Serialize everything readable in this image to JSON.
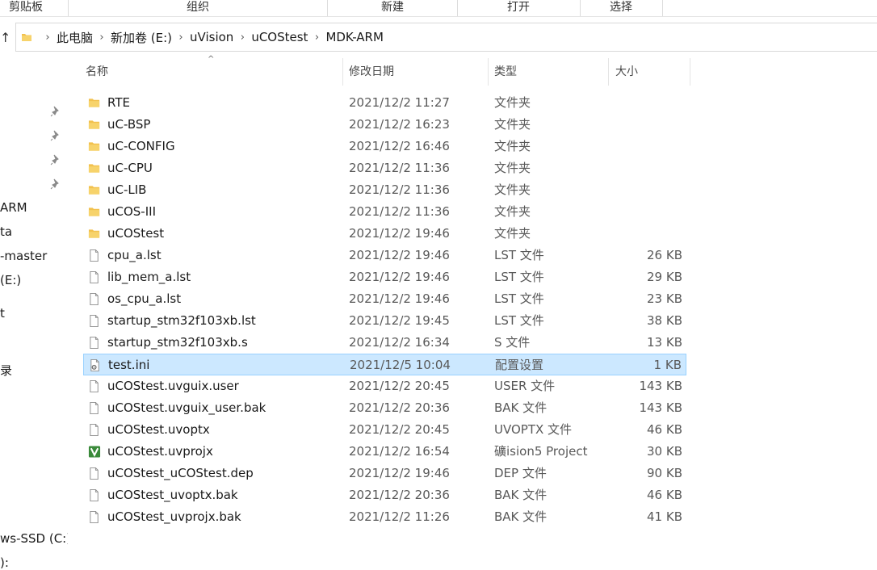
{
  "ribbon": {
    "groups": [
      "剪贴板",
      "组织",
      "新建",
      "打开",
      "选择"
    ]
  },
  "address": {
    "crumbs": [
      "此电脑",
      "新加卷 (E:)",
      "uVision",
      "uCOStest",
      "MDK-ARM"
    ]
  },
  "nav": {
    "items": [
      "ARM",
      "ta",
      "-master",
      "(E:)",
      "t",
      "录",
      "ws-SSD (C:)",
      "):"
    ]
  },
  "columns": {
    "name": "名称",
    "date": "修改日期",
    "type": "类型",
    "size": "大小"
  },
  "colors": {
    "selected_bg": "#cce8ff",
    "selected_border": "#99d1ff",
    "folder": "#f2c14e",
    "uvprojx": "#3a8a3a"
  },
  "files": [
    {
      "name": "RTE",
      "date": "2021/12/2 11:27",
      "type": "文件夹",
      "size": "",
      "icon": "folder-icon"
    },
    {
      "name": "uC-BSP",
      "date": "2021/12/2 16:23",
      "type": "文件夹",
      "size": "",
      "icon": "folder-icon"
    },
    {
      "name": "uC-CONFIG",
      "date": "2021/12/2 16:46",
      "type": "文件夹",
      "size": "",
      "icon": "folder-icon"
    },
    {
      "name": "uC-CPU",
      "date": "2021/12/2 11:36",
      "type": "文件夹",
      "size": "",
      "icon": "folder-icon"
    },
    {
      "name": "uC-LIB",
      "date": "2021/12/2 11:36",
      "type": "文件夹",
      "size": "",
      "icon": "folder-icon"
    },
    {
      "name": "uCOS-III",
      "date": "2021/12/2 11:36",
      "type": "文件夹",
      "size": "",
      "icon": "folder-icon"
    },
    {
      "name": "uCOStest",
      "date": "2021/12/2 19:46",
      "type": "文件夹",
      "size": "",
      "icon": "folder-icon"
    },
    {
      "name": "cpu_a.lst",
      "date": "2021/12/2 19:46",
      "type": "LST 文件",
      "size": "26 KB",
      "icon": "file-icon"
    },
    {
      "name": "lib_mem_a.lst",
      "date": "2021/12/2 19:46",
      "type": "LST 文件",
      "size": "29 KB",
      "icon": "file-icon"
    },
    {
      "name": "os_cpu_a.lst",
      "date": "2021/12/2 19:46",
      "type": "LST 文件",
      "size": "23 KB",
      "icon": "file-icon"
    },
    {
      "name": "startup_stm32f103xb.lst",
      "date": "2021/12/2 19:45",
      "type": "LST 文件",
      "size": "38 KB",
      "icon": "file-icon"
    },
    {
      "name": "startup_stm32f103xb.s",
      "date": "2021/12/2 16:34",
      "type": "S 文件",
      "size": "13 KB",
      "icon": "file-icon"
    },
    {
      "name": "test.ini",
      "date": "2021/12/5 10:04",
      "type": "配置设置",
      "size": "1 KB",
      "icon": "settings-file-icon",
      "selected": true
    },
    {
      "name": "uCOStest.uvguix.user",
      "date": "2021/12/2 20:45",
      "type": "USER 文件",
      "size": "143 KB",
      "icon": "file-icon"
    },
    {
      "name": "uCOStest.uvguix_user.bak",
      "date": "2021/12/2 20:36",
      "type": "BAK 文件",
      "size": "143 KB",
      "icon": "file-icon"
    },
    {
      "name": "uCOStest.uvoptx",
      "date": "2021/12/2 20:45",
      "type": "UVOPTX 文件",
      "size": "46 KB",
      "icon": "file-icon"
    },
    {
      "name": "uCOStest.uvprojx",
      "date": "2021/12/2 16:54",
      "type": "礦ision5 Project",
      "size": "30 KB",
      "icon": "uvision-project-icon"
    },
    {
      "name": "uCOStest_uCOStest.dep",
      "date": "2021/12/2 19:46",
      "type": "DEP 文件",
      "size": "90 KB",
      "icon": "file-icon"
    },
    {
      "name": "uCOStest_uvoptx.bak",
      "date": "2021/12/2 20:36",
      "type": "BAK 文件",
      "size": "46 KB",
      "icon": "file-icon"
    },
    {
      "name": "uCOStest_uvprojx.bak",
      "date": "2021/12/2 11:26",
      "type": "BAK 文件",
      "size": "41 KB",
      "icon": "file-icon"
    }
  ]
}
